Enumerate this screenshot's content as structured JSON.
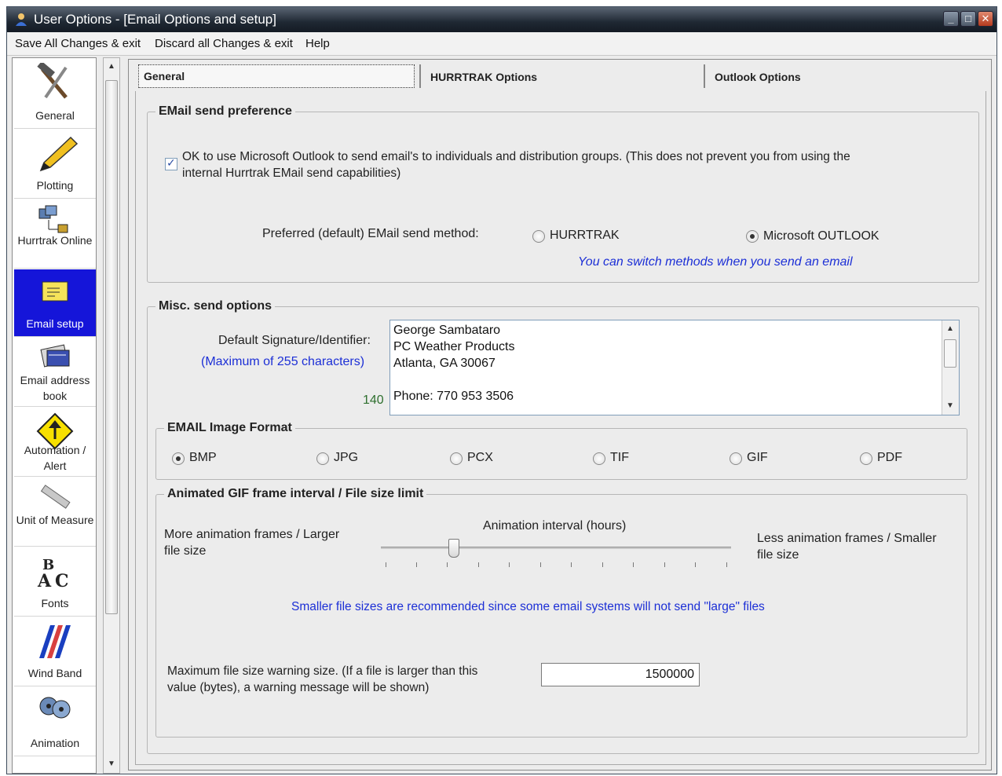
{
  "window": {
    "title": "User Options - [Email Options and setup]"
  },
  "menu": {
    "save": "Save All Changes & exit",
    "discard": "Discard all Changes & exit",
    "help": "Help"
  },
  "nav": {
    "items": [
      {
        "label": "General",
        "icon": "hammer-icon"
      },
      {
        "label": "Plotting",
        "icon": "pencil-icon"
      },
      {
        "label": "Hurrtrak Online",
        "icon": "network-icon"
      },
      {
        "label": "Email setup",
        "icon": "envelope-icon"
      },
      {
        "label": "Email address book",
        "icon": "address-book-icon"
      },
      {
        "label": "Automation / Alert",
        "icon": "alert-icon"
      },
      {
        "label": "Unit of Measure",
        "icon": "ruler-icon"
      },
      {
        "label": "Fonts",
        "icon": "fonts-icon"
      },
      {
        "label": "Wind Band",
        "icon": "wind-band-icon"
      },
      {
        "label": "Animation",
        "icon": "film-icon"
      }
    ],
    "active_index": 3,
    "active_color": "#1515d9"
  },
  "tabs": {
    "general": "General",
    "hurrtrak": "HURRTRAK Options",
    "outlook": "Outlook Options"
  },
  "send_pref": {
    "title": "EMail send preference",
    "ok_outlook_checked": true,
    "ok_outlook_line1": "OK to use Microsoft Outlook to send email's to individuals and distribution groups.  (This does not prevent you from using the",
    "ok_outlook_line2": "internal Hurrtrak EMail send capabilities)",
    "method_label": "Preferred (default) EMail send method:",
    "method_hurrtrak": "HURRTRAK",
    "method_outlook": "Microsoft OUTLOOK",
    "selected_method": "Microsoft OUTLOOK",
    "switch_note": "You can switch methods when you send an email"
  },
  "misc": {
    "title": "Misc. send options",
    "signature_label": "Default Signature/Identifier:",
    "signature_max": "(Maximum of 255 characters)",
    "char_count": "140",
    "signature_lines": [
      "George Sambataro",
      "PC Weather Products",
      "Atlanta, GA  30067",
      "",
      "Phone: 770 953 3506"
    ]
  },
  "image_format": {
    "title": "EMAIL Image Format",
    "options": [
      "BMP",
      "JPG",
      "PCX",
      "TIF",
      "GIF",
      "PDF"
    ],
    "selected": "BMP"
  },
  "gif": {
    "title": "Animated GIF frame interval / File size limit",
    "left_line1": "More animation frames / Larger",
    "left_line2": "file size",
    "center_label": "Animation interval (hours)",
    "right_line1": "Less animation frames / Smaller",
    "right_line2": "file size",
    "slider_position": 0.2,
    "note": "Smaller file sizes are recommended since some email systems will not send \"large\" files",
    "max_size_line1": "Maximum file size warning size.  (If a file is larger than this",
    "max_size_line2": "value (bytes), a warning message will be shown)",
    "max_size_value": "1500000"
  }
}
